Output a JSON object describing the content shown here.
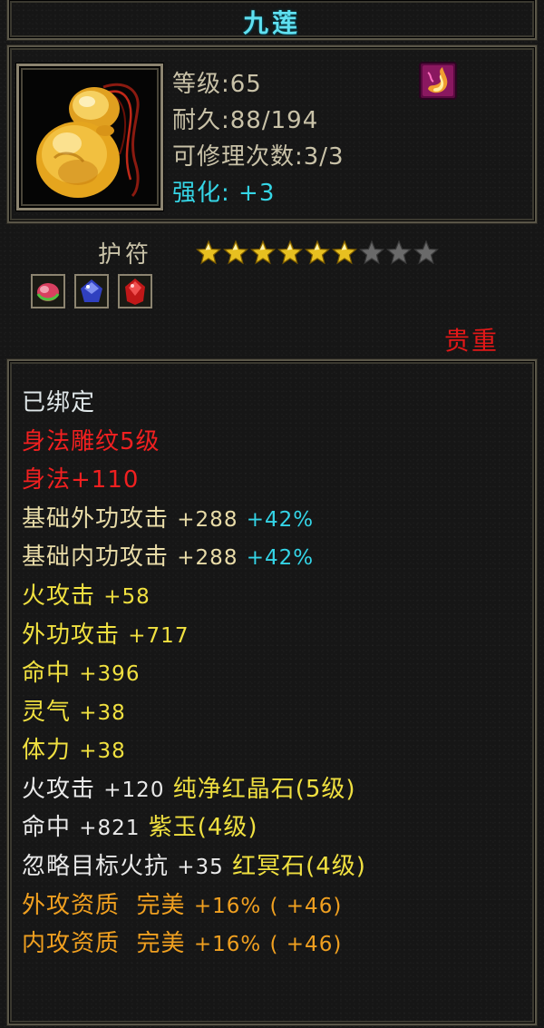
{
  "item": {
    "name": "九莲",
    "level": "等级:65",
    "durability": "耐久:88/194",
    "repair": "可修理次数:3/3",
    "enhance_label": "强化:",
    "enhance_value": "+3"
  },
  "amulet": {
    "label": "护符",
    "stars_filled": 6,
    "stars_total": 9,
    "rarity": "贵重"
  },
  "gems": [
    "red-green-gem-icon",
    "blue-gem-icon",
    "red-gem-icon"
  ],
  "attributes": {
    "bound": "已绑定",
    "carving": "身法雕纹5级",
    "agility": "身法+110",
    "base_ext_attack": {
      "label": "基础外功攻击",
      "value": "+288",
      "pct": "+42%"
    },
    "base_int_attack": {
      "label": "基础内功攻击",
      "value": "+288",
      "pct": "+42%"
    },
    "fire_attack": {
      "label": "火攻击",
      "value": "+58"
    },
    "ext_attack": {
      "label": "外功攻击",
      "value": "+717"
    },
    "hit": {
      "label": "命中",
      "value": "+396"
    },
    "spirit": {
      "label": "灵气",
      "value": "+38"
    },
    "stamina": {
      "label": "体力",
      "value": "+38"
    },
    "gem_fire": {
      "label": "火攻击",
      "value": "+120",
      "gem": "纯净红晶石(5级)"
    },
    "gem_hit": {
      "label": "命中",
      "value": "+821",
      "gem": "紫玉(4级)"
    },
    "gem_ignore": {
      "label": "忽略目标火抗",
      "value": "+35",
      "gem": "红冥石(4级)"
    },
    "ext_quality": {
      "label": "外攻资质",
      "grade": "完美",
      "value": "+16%",
      "bonus": "( +46)"
    },
    "int_quality": {
      "label": "内攻资质",
      "grade": "完美",
      "value": "+16%",
      "bonus": "( +46)"
    }
  },
  "colors": {
    "title": "#5fe0f0",
    "stat": "#c9c2a8",
    "enhance": "#35d6e6",
    "rarity": "#e21818",
    "carving": "#f02020",
    "base_attr": "#e9dca8",
    "yellow_attr": "#f0e040",
    "gem_name": "#f0e040",
    "quality": "#f0a020",
    "star_filled": "#e8c020",
    "star_empty": "#6a6a6a"
  }
}
